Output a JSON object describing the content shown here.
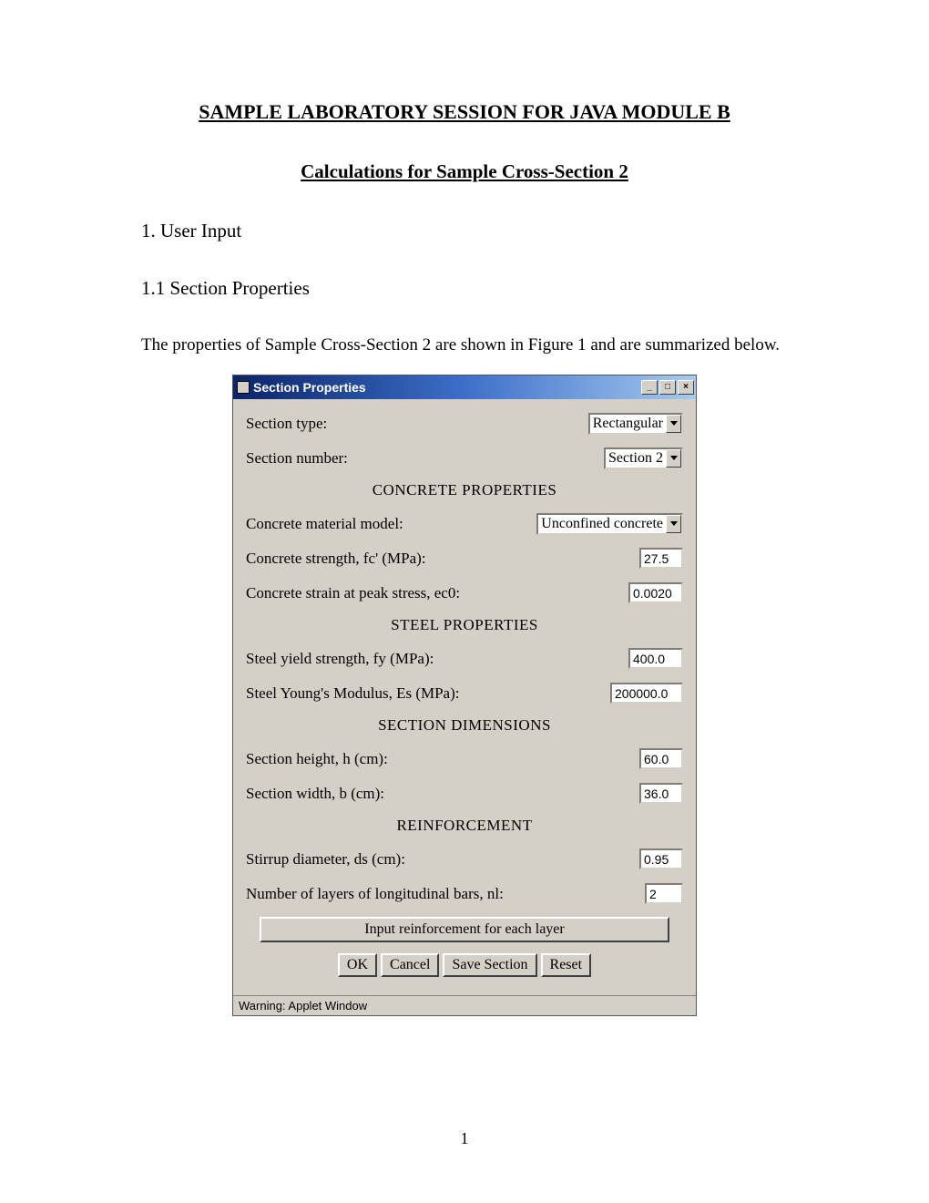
{
  "doc": {
    "title": "SAMPLE LABORATORY SESSION FOR JAVA MODULE B",
    "subtitle": "Calculations for Sample Cross-Section 2",
    "h1": "1.  User Input",
    "h2": "1.1 Section Properties",
    "p1": "The properties of Sample Cross-Section 2 are shown in Figure 1 and are summarized below.",
    "page_number": "1"
  },
  "dialog": {
    "title": "Section Properties",
    "status": "Warning: Applet Window",
    "labels": {
      "section_type": "Section type:",
      "section_number": "Section number:",
      "concrete_header": "CONCRETE PROPERTIES",
      "concrete_model": "Concrete material model:",
      "concrete_strength": "Concrete strength, fc' (MPa):",
      "concrete_strain": "Concrete strain at peak stress, ec0:",
      "steel_header": "STEEL PROPERTIES",
      "steel_yield": "Steel yield strength, fy (MPa):",
      "steel_modulus": "Steel Young's Modulus, Es (MPa):",
      "dims_header": "SECTION DIMENSIONS",
      "section_height": "Section height, h (cm):",
      "section_width": "Section width, b (cm):",
      "reinf_header": "REINFORCEMENT",
      "stirrup_d": "Stirrup diameter, ds (cm):",
      "num_layers": "Number of layers of longitudinal bars, nl:"
    },
    "values": {
      "section_type": "Rectangular",
      "section_number": "Section 2",
      "concrete_model": "Unconfined concrete",
      "concrete_strength": "27.5",
      "concrete_strain": "0.0020",
      "steel_yield": "400.0",
      "steel_modulus": "200000.0",
      "section_height": "60.0",
      "section_width": "36.0",
      "stirrup_d": "0.95",
      "num_layers": "2"
    },
    "buttons": {
      "wide": "Input reinforcement for each layer",
      "ok": "OK",
      "cancel": "Cancel",
      "save": "Save Section",
      "reset": "Reset"
    }
  }
}
